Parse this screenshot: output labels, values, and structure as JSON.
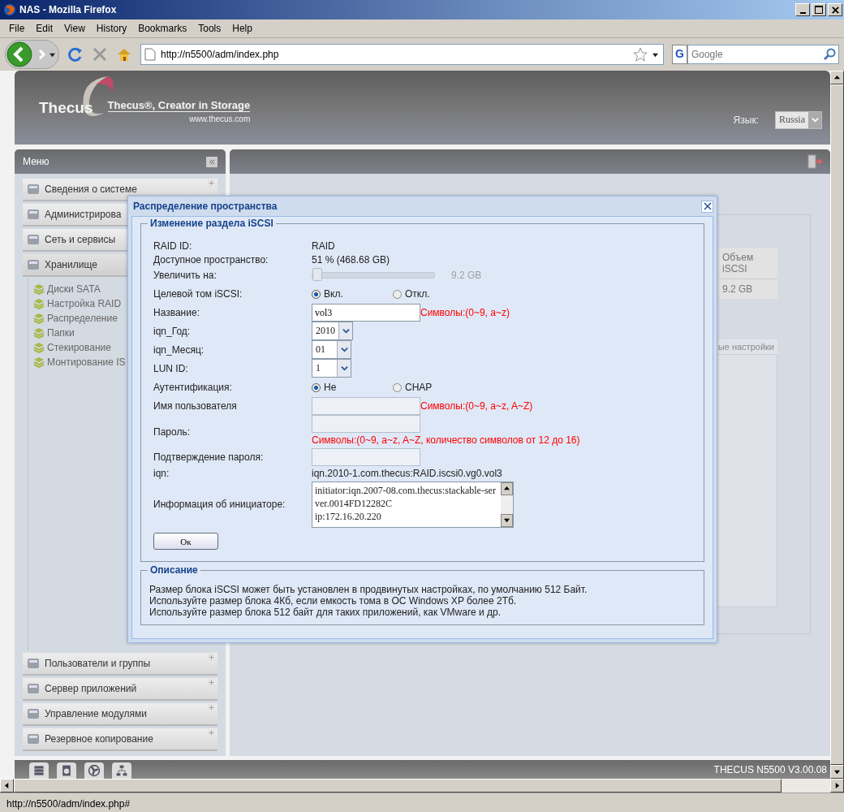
{
  "window": {
    "title": "NAS - Mozilla Firefox"
  },
  "menu_bar": [
    "File",
    "Edit",
    "View",
    "History",
    "Bookmarks",
    "Tools",
    "Help"
  ],
  "toolbar": {
    "url": "http://n5500/adm/index.php",
    "search_placeholder": "Google",
    "search_engine": "G"
  },
  "header": {
    "logo": "Thecus",
    "slogan": "Thecus®, Creator in Storage",
    "site": "www.thecus.com",
    "language_label": "Язык:",
    "language": "Russia"
  },
  "menu": {
    "title": "Меню",
    "sections": [
      {
        "label": "Сведения о системе",
        "expanded": false
      },
      {
        "label": "Администрирова",
        "expanded": false
      },
      {
        "label": "Сеть и сервисы",
        "expanded": false
      },
      {
        "label": "Хранилище",
        "expanded": true,
        "children": [
          "Диски SATA",
          "Настройка RAID",
          "Распределение",
          "Папки",
          "Стекирование",
          "Монтирование IS"
        ]
      },
      {
        "label": "Пользователи и группы",
        "expanded": false
      },
      {
        "label": "Сервер приложений",
        "expanded": false
      },
      {
        "label": "Управление модулями",
        "expanded": false
      },
      {
        "label": "Резервное копирование",
        "expanded": false
      }
    ]
  },
  "content": {
    "table_header": "Объем iSCSI",
    "table_cell": "9.2 GB",
    "tab": "ые настройки"
  },
  "footer": {
    "version": "THECUS N5500 V3.00.08"
  },
  "dialog": {
    "title": "Распределение пространства",
    "legend": "Изменение раздела iSCSI",
    "rows": [
      {
        "kind": "text",
        "label": "RAID ID:",
        "value": "RAID"
      },
      {
        "kind": "text",
        "label": "Доступное пространство:",
        "value": "51 % (468.68 GB)"
      },
      {
        "kind": "slider",
        "label": "Увеличить на:",
        "level": 0,
        "reading": "9.2 GB",
        "disabled": true
      },
      {
        "kind": "radio",
        "label": "Целевой том iSCSI:",
        "options": [
          {
            "label": "Вкл.",
            "selected": true
          },
          {
            "label": "Откл.",
            "selected": false
          }
        ]
      },
      {
        "kind": "input",
        "label": "Название:",
        "value": "vol3",
        "hint": "Символы:(0~9, a~z)",
        "disabled": false
      },
      {
        "kind": "select",
        "label": "iqn_Год:",
        "value": "2010"
      },
      {
        "kind": "select",
        "label": "iqn_Месяц:",
        "value": "01"
      },
      {
        "kind": "select",
        "label": "LUN ID:",
        "value": "1"
      },
      {
        "kind": "radio",
        "label": "Аутентификация:",
        "options": [
          {
            "label": "Не",
            "selected": true
          },
          {
            "label": "CHAP",
            "selected": false
          }
        ]
      },
      {
        "kind": "input",
        "label": "Имя пользователя",
        "hint": "Символы:(0~9, a~z, A~Z)",
        "disabled": true
      },
      {
        "kind": "input",
        "label": "Пароль:",
        "note": "Символы:(0~9, a~z, A~Z, количество символов от 12 до 16)",
        "disabled": true
      },
      {
        "kind": "input",
        "label": "Подтверждение пароля:",
        "disabled": true
      },
      {
        "kind": "text",
        "label": "iqn:",
        "value": "iqn.2010-1.com.thecus:RAID.iscsi0.vg0.vol3"
      },
      {
        "kind": "textarea",
        "label": "Информация об инициаторе:",
        "lines": [
          "initiator:iqn.2007-08.com.thecus:stackable-server.0014FD12282C",
          "ip:172.16.20.220"
        ]
      }
    ],
    "button": "Ок",
    "description_legend": "Описание",
    "description": [
      "Размер блока iSCSI может быть установлен в продвинутых настройках, по умолчанию 512 Байт.",
      "Используйте размер блока 4Кб, если емкость тома в ОС Windows XP более 2Тб.",
      "Используйте размер блока 512 байт для таких приложений, как VMware и др."
    ]
  },
  "status_bar": "http://n5500/adm/index.php#"
}
